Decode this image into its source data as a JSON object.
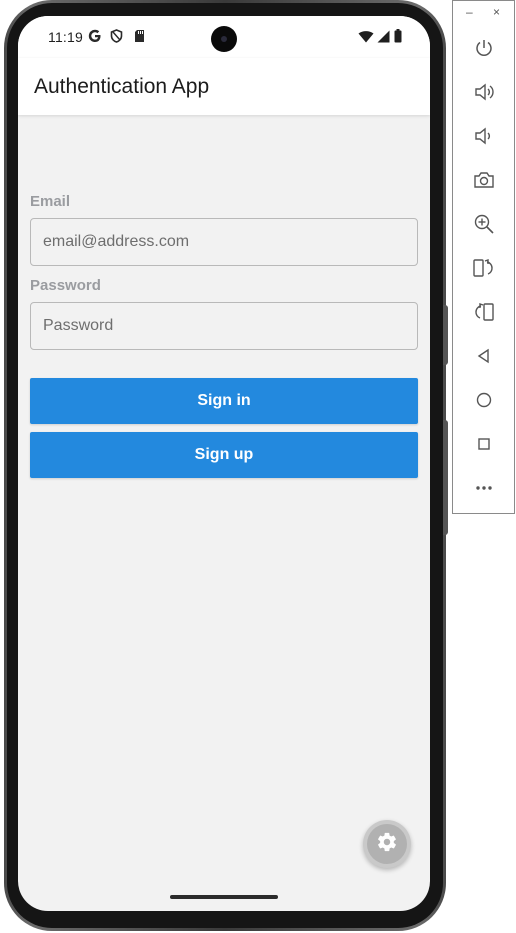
{
  "status_bar": {
    "time": "11:19",
    "left_icons": [
      "google-g-icon",
      "shield-icon",
      "sd-card-icon"
    ],
    "right_icons": [
      "wifi-icon",
      "signal-icon",
      "battery-icon"
    ]
  },
  "app_bar": {
    "title": "Authentication App"
  },
  "form": {
    "email_label": "Email",
    "email_placeholder": "email@address.com",
    "email_value": "",
    "password_label": "Password",
    "password_placeholder": "Password",
    "password_value": ""
  },
  "buttons": {
    "sign_in": "Sign in",
    "sign_up": "Sign up"
  },
  "fab": {
    "icon": "gear-icon"
  },
  "colors": {
    "primary": "#2389de",
    "background": "#f2f2f2",
    "label": "#9a9ca0"
  },
  "emulator_toolbar": {
    "minimize": "–",
    "close": "×",
    "buttons": [
      "power-icon",
      "volume-up-icon",
      "volume-down-icon",
      "camera-icon",
      "zoom-in-icon",
      "rotate-left-icon",
      "rotate-right-icon",
      "back-icon",
      "home-icon",
      "overview-icon",
      "more-icon"
    ]
  }
}
